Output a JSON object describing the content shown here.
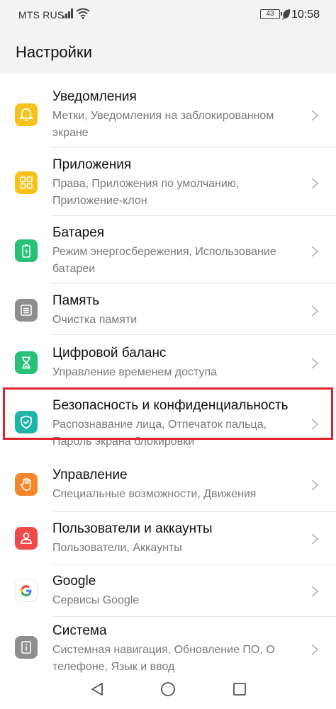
{
  "status_bar": {
    "carrier": "MTS RUS",
    "battery": "43",
    "time": "10:58"
  },
  "header": {
    "title": "Настройки"
  },
  "items": [
    {
      "title": "Уведомления",
      "subtitle": "Метки, Уведомления на заблокированном экране",
      "icon": "bell-icon",
      "color": "#f7c21c"
    },
    {
      "title": "Приложения",
      "subtitle": "Права, Приложения по умолчанию, Приложение-клон",
      "icon": "apps-grid-icon",
      "color": "#f7c21c"
    },
    {
      "title": "Батарея",
      "subtitle": "Режим энергосбережения, Использование батареи",
      "icon": "battery-charge-icon",
      "color": "#27c178"
    },
    {
      "title": "Память",
      "subtitle": "Очистка памяти",
      "icon": "storage-icon",
      "color": "#8e8e8e"
    },
    {
      "title": "Цифровой баланс",
      "subtitle": "Управление временем доступа",
      "icon": "hourglass-icon",
      "color": "#27c178"
    },
    {
      "title": "Безопасность и конфиденциальность",
      "subtitle": "Распознавание лица, Отпечаток пальца, Пароль экрана блокировки",
      "icon": "shield-check-icon",
      "color": "#1fb5a8"
    },
    {
      "title": "Управление",
      "subtitle": "Специальные возможности, Движения",
      "icon": "hand-icon",
      "color": "#f5872a"
    },
    {
      "title": "Пользователи и аккаунты",
      "subtitle": "Пользователи, Аккаунты",
      "icon": "user-icon",
      "color": "#ee4a4a"
    },
    {
      "title": "Google",
      "subtitle": "Сервисы Google",
      "icon": "google-icon",
      "color": "#ffffff"
    },
    {
      "title": "Система",
      "subtitle": "Системная навигация, Обновление ПО, О телефоне, Язык и ввод",
      "icon": "info-icon",
      "color": "#8e8e8e"
    }
  ],
  "highlight_color": "#e0252c"
}
